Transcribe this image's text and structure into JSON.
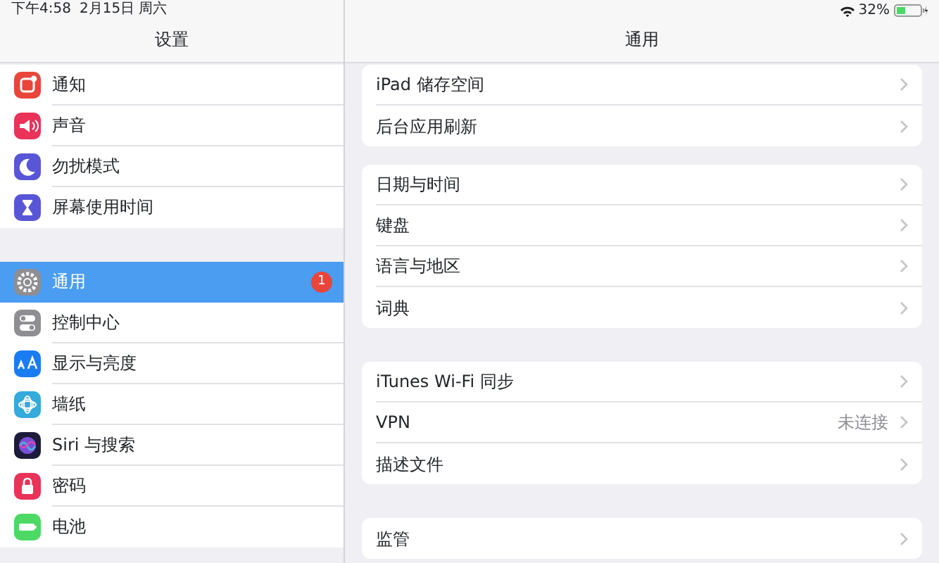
{
  "status_bar": {
    "time": "下午4:58",
    "date": "2月15日 周六",
    "battery": "32%"
  },
  "sidebar": {
    "title": "设置",
    "groups": [
      [
        {
          "label": "通知",
          "kind": "notifications",
          "color": "#e9453a",
          "selected": false
        },
        {
          "label": "声音",
          "kind": "sounds",
          "color": "#e93358",
          "selected": false
        },
        {
          "label": "勿扰模式",
          "kind": "moon",
          "color": "#5856d6",
          "selected": false
        },
        {
          "label": "屏幕使用时间",
          "kind": "hourglass",
          "color": "#5856d6",
          "selected": false
        }
      ],
      [
        {
          "label": "通用",
          "kind": "gear",
          "color": "#8e8e93",
          "selected": true,
          "badge": "1"
        },
        {
          "label": "控制中心",
          "kind": "toggles",
          "color": "#8e8e93",
          "selected": false
        },
        {
          "label": "显示与亮度",
          "kind": "text-size",
          "color": "#1a7cf2",
          "selected": false
        },
        {
          "label": "墙纸",
          "kind": "flower",
          "color": "#35aadc",
          "selected": false
        },
        {
          "label": "Siri 与搜索",
          "kind": "siri",
          "color": "#1c1c3a",
          "selected": false
        },
        {
          "label": "密码",
          "kind": "lock",
          "color": "#e93358",
          "selected": false
        },
        {
          "label": "电池",
          "kind": "battery",
          "color": "#4cd964",
          "selected": false
        }
      ]
    ]
  },
  "detail": {
    "title": "通用",
    "groups": [
      [
        {
          "label": "iPad 储存空间"
        },
        {
          "label": "后台应用刷新"
        }
      ],
      [
        {
          "label": "日期与时间"
        },
        {
          "label": "键盘"
        },
        {
          "label": "语言与地区"
        },
        {
          "label": "词典"
        }
      ],
      [
        {
          "label": "iTunes Wi-Fi 同步"
        },
        {
          "label": "VPN",
          "value": "未连接"
        },
        {
          "label": "描述文件"
        }
      ],
      [
        {
          "label": "监管"
        }
      ]
    ]
  }
}
